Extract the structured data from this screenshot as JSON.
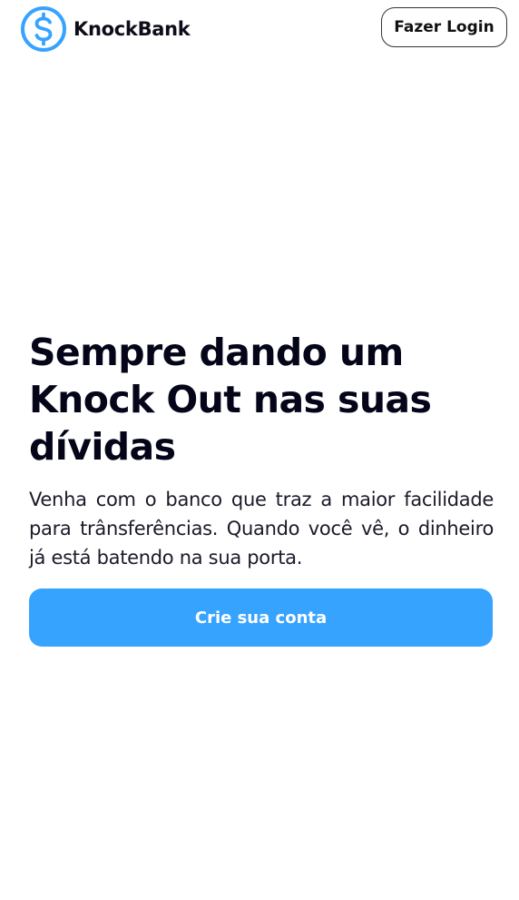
{
  "header": {
    "brand_name": "KnockBank",
    "logo_icon": "dollar-circle-icon",
    "login_label": "Fazer Login"
  },
  "hero": {
    "title": "Sempre dando um Knock Out nas suas dívidas",
    "description": "Venha com o banco que traz a maior facilidade para trânsferências. Quando você vê, o dinheiro já está batendo na sua porta.",
    "cta_label": "Crie sua conta"
  },
  "colors": {
    "accent": "#36a3ff",
    "text": "#05051a",
    "background": "#ffffff"
  }
}
